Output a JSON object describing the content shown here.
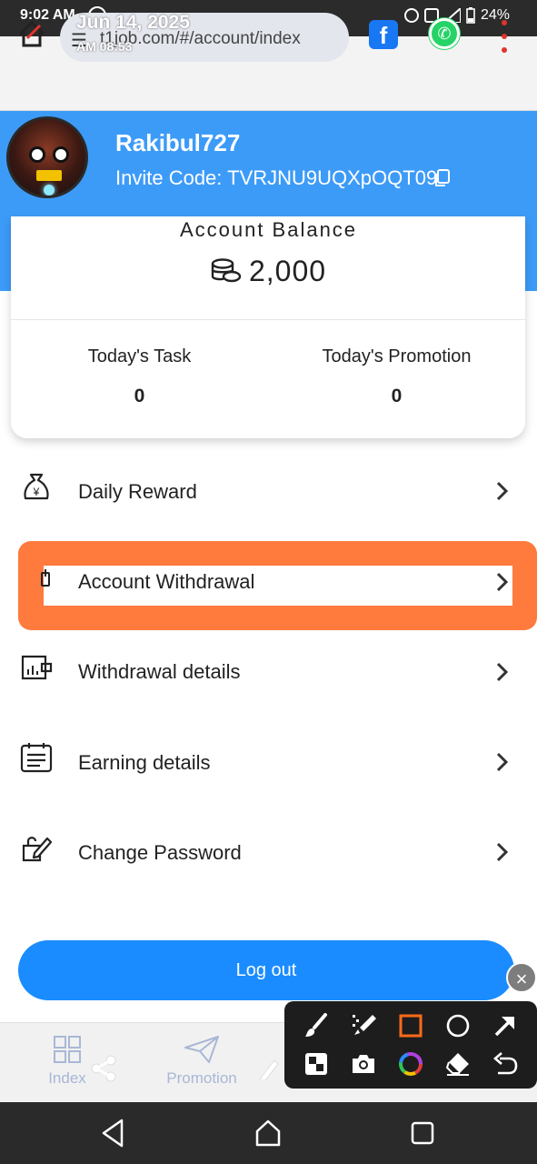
{
  "status_bar": {
    "time": "9:02 AM",
    "battery": "24%",
    "rec_icon": "screen-record-icon",
    "icons": [
      "alarm-icon",
      "cast-icon",
      "signal-icon",
      "battery-icon"
    ]
  },
  "browser": {
    "url": "t1job.com/#/account/index",
    "overlay_date": "Jun 14, 2025",
    "overlay_time": "AM 08:53",
    "icons": [
      "home-icon",
      "site-settings-icon",
      "facebook-icon",
      "whatsapp-icon",
      "overflow-menu-icon"
    ]
  },
  "profile": {
    "username": "Rakibul727",
    "invite_label": "Invite Code: ",
    "invite_code": "TVRJNU9UQXpOQT09"
  },
  "balance": {
    "title": "Account Balance",
    "value": "2,000",
    "stats": [
      {
        "label": "Today's Task",
        "value": "0"
      },
      {
        "label": "Today's Promotion",
        "value": "0"
      }
    ]
  },
  "menu": [
    {
      "label": "Daily Reward",
      "icon": "money-bag-icon"
    },
    {
      "label": "Account Withdrawal",
      "icon": "withdraw-icon"
    },
    {
      "label": "Withdrawal details",
      "icon": "wallet-icon"
    },
    {
      "label": "Earning details",
      "icon": "calendar-list-icon"
    },
    {
      "label": "Change Password",
      "icon": "edit-lock-icon"
    }
  ],
  "logout_label": "Log out",
  "tabs": [
    {
      "label": "Index",
      "icon": "grid-icon"
    },
    {
      "label": "Promotion",
      "icon": "paper-plane-icon"
    }
  ],
  "annotation_tools": [
    "brush-icon",
    "marker-icon",
    "rectangle-icon",
    "circle-icon",
    "arrow-icon",
    "mosaic-icon",
    "camera-icon",
    "color-wheel-icon",
    "eraser-icon",
    "undo-icon"
  ],
  "colors": {
    "brand_blue": "#3d9bf8",
    "logout_blue": "#1a8cff",
    "highlight_orange": "#ff7a3d",
    "annotation_rect": "#ff6a1a"
  }
}
